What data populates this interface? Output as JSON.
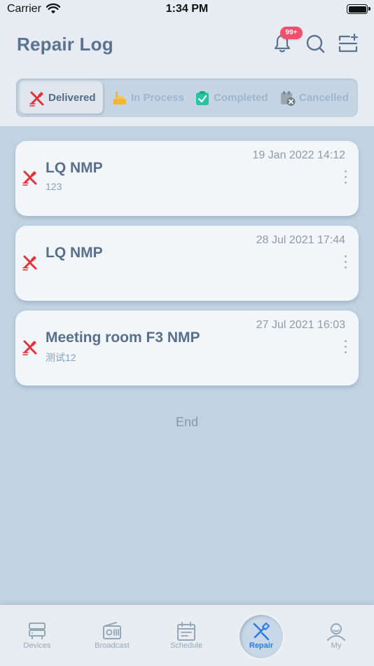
{
  "status_bar": {
    "carrier": "Carrier",
    "time": "1:34 PM"
  },
  "header": {
    "title": "Repair Log",
    "notification_badge": "99+",
    "icons": [
      "bell-icon",
      "search-icon",
      "scan-add-icon"
    ]
  },
  "tabs": [
    {
      "label": "Delivered",
      "icon": "repair-tools-icon",
      "selected": true
    },
    {
      "label": "In Process",
      "icon": "hand-icon",
      "selected": false
    },
    {
      "label": "Completed",
      "icon": "clipboard-check-icon",
      "selected": false
    },
    {
      "label": "Cancelled",
      "icon": "calendar-cancel-icon",
      "selected": false
    }
  ],
  "records": [
    {
      "title": "LQ NMP",
      "subtitle": "123",
      "time": "19 Jan 2022 14:12"
    },
    {
      "title": "LQ NMP",
      "subtitle": "",
      "time": "28 Jul 2021 17:44"
    },
    {
      "title": "Meeting room F3 NMP",
      "subtitle": "测试12",
      "time": "27 Jul 2021 16:03"
    }
  ],
  "end_label": "End",
  "nav": [
    {
      "label": "Devices",
      "icon": "devices-icon",
      "active": false
    },
    {
      "label": "Broadcast",
      "icon": "broadcast-icon",
      "active": false
    },
    {
      "label": "Schedule",
      "icon": "schedule-icon",
      "active": false
    },
    {
      "label": "Repair",
      "icon": "repair-icon",
      "active": true
    },
    {
      "label": "My",
      "icon": "user-icon",
      "active": false
    }
  ],
  "colors": {
    "accent": "#2a7be4",
    "repair_red": "#e0323a",
    "badge": "#f0506b",
    "title": "#5a7390"
  }
}
